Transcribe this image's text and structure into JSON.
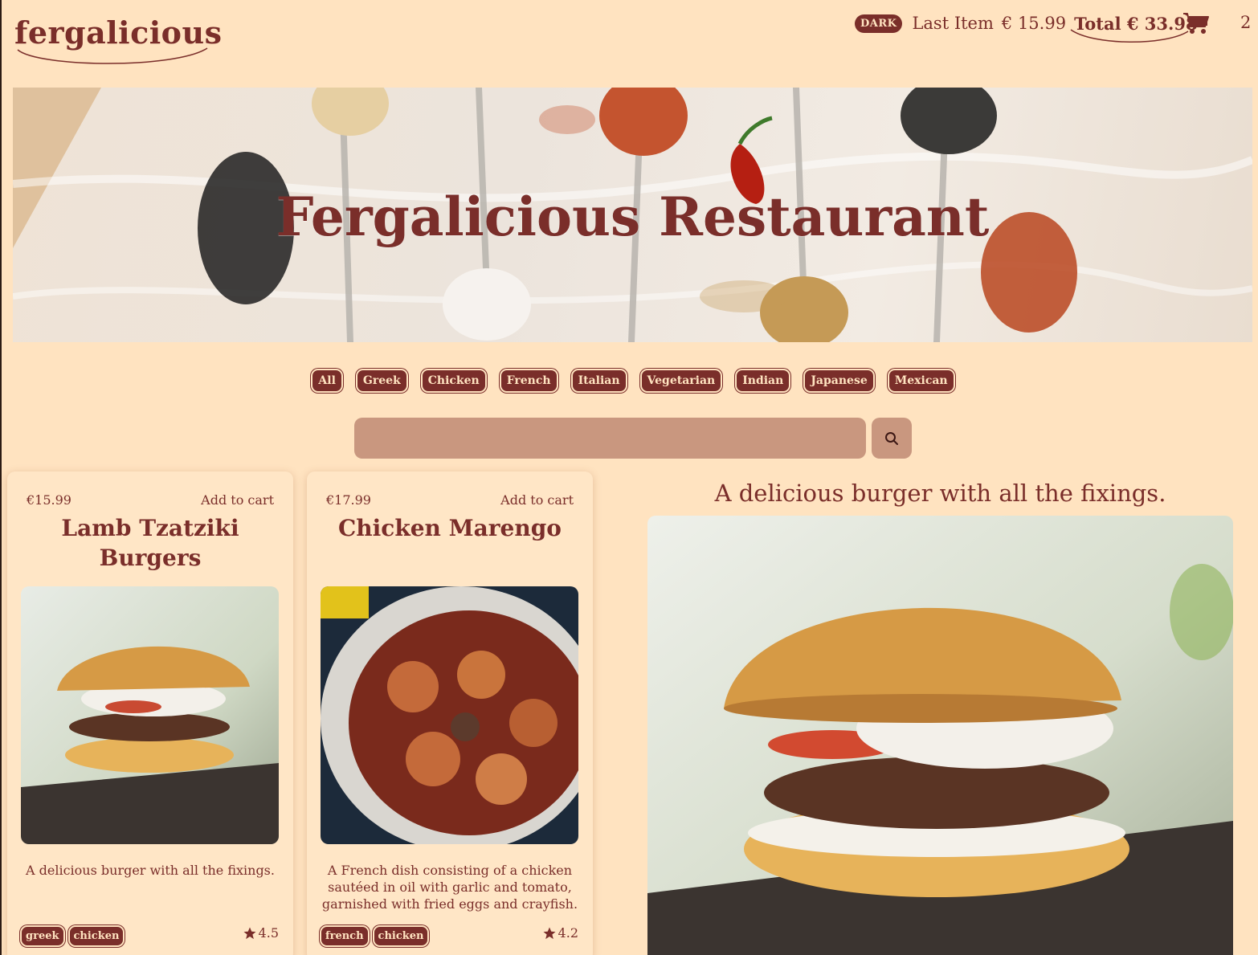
{
  "header": {
    "logo": "fergalicious",
    "dark_toggle": "DARK",
    "last_item_label": "Last Item",
    "last_item_price": "€ 15.99",
    "total_label": "Total € 33.98",
    "cart_icon": "shopping-cart-icon",
    "cart_count": "2"
  },
  "hero": {
    "title": "Fergalicious Restaurant"
  },
  "filters": [
    "All",
    "Greek",
    "Chicken",
    "French",
    "Italian",
    "Vegetarian",
    "Indian",
    "Japanese",
    "Mexican"
  ],
  "search": {
    "value": "",
    "icon": "search-icon"
  },
  "cards": [
    {
      "price": "€15.99",
      "add_label": "Add to cart",
      "title": "Lamb Tzatziki Burgers",
      "image": "burger-photo",
      "description": "A delicious burger with all the fixings.",
      "tags": [
        "greek",
        "chicken"
      ],
      "rating": "4.5"
    },
    {
      "price": "€17.99",
      "add_label": "Add to cart",
      "title": "Chicken Marengo",
      "image": "chicken-marengo-photo",
      "description": "A French dish consisting of a chicken sautéed in oil with garlic and tomato, garnished with fried eggs and crayfish.",
      "tags": [
        "french",
        "chicken"
      ],
      "rating": "4.2"
    }
  ],
  "detail": {
    "title": "A delicious burger with all the fixings.",
    "image": "burger-photo-large"
  },
  "colors": {
    "background": "#ffe3c0",
    "accent": "#7a2e2a",
    "search_field": "#c9977f"
  }
}
